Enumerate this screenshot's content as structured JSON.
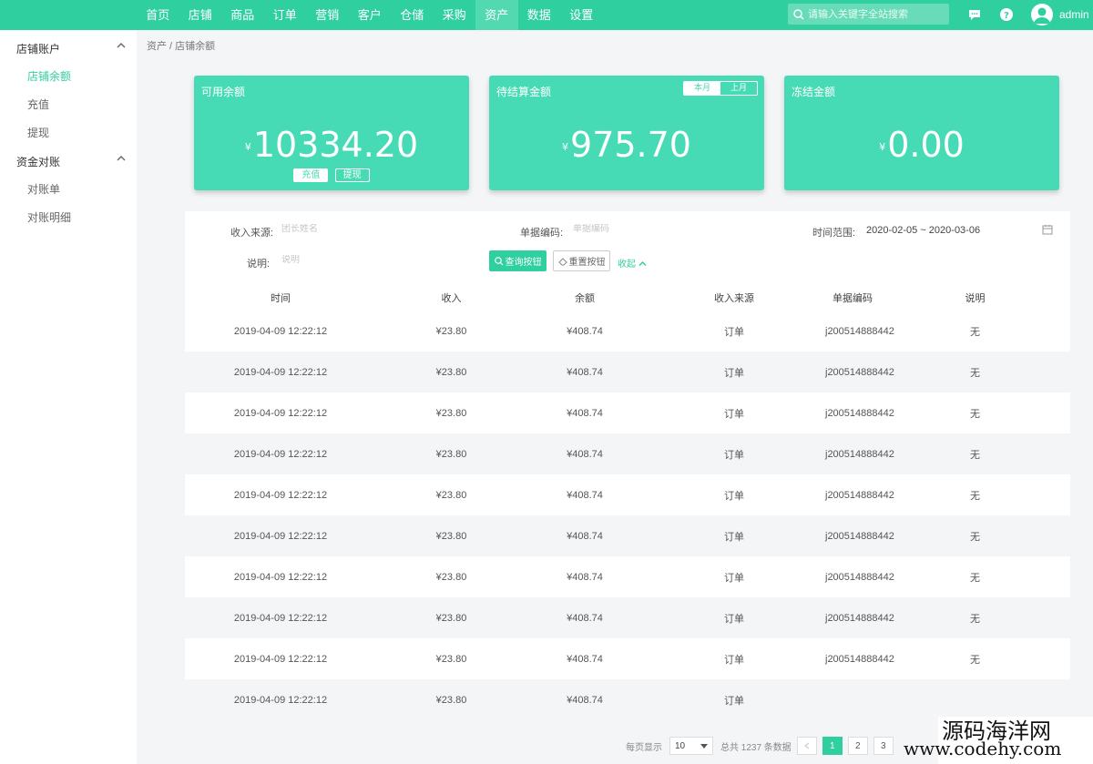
{
  "nav": {
    "items": [
      "首页",
      "店铺",
      "商品",
      "订单",
      "营销",
      "客户",
      "仓储",
      "采购",
      "资产",
      "数据",
      "设置"
    ],
    "active_index": 8,
    "search_placeholder": "请输入关键字全站搜索",
    "user": "admin"
  },
  "sidebar": {
    "groups": [
      {
        "title": "店铺账户",
        "items": [
          "店铺余额",
          "充值",
          "提现"
        ]
      },
      {
        "title": "资金对账",
        "items": [
          "对账单",
          "对账明细"
        ]
      }
    ],
    "active_item": "店铺余额"
  },
  "breadcrumb": "资产 / 店铺余额",
  "cards": {
    "available": {
      "title": "可用余额",
      "currency": "¥",
      "amount": "10334.20",
      "btn_recharge": "充值",
      "btn_withdraw": "提现"
    },
    "pending": {
      "title": "待结算金额",
      "currency": "¥",
      "amount": "975.70",
      "toggle_this": "本月",
      "toggle_last": "上月"
    },
    "frozen": {
      "title": "冻结金额",
      "currency": "¥",
      "amount": "0.00"
    }
  },
  "filter": {
    "source_label": "收入来源:",
    "source_placeholder": "团长姓名",
    "code_label": "单据编码:",
    "code_placeholder": "单据编码",
    "time_label": "时间范围:",
    "time_value": "2020-02-05 ~ 2020-03-06",
    "note_label": "说明:",
    "note_placeholder": "说明",
    "query_btn": "查询按钮",
    "reset_btn": "重置按钮",
    "collapse": "收起"
  },
  "table": {
    "headers": [
      "时间",
      "收入",
      "余额",
      "收入来源",
      "单据编码",
      "说明"
    ],
    "rows": [
      [
        "2019-04-09 12:22:12",
        "¥23.80",
        "¥408.74",
        "订单",
        "j200514888442",
        "无"
      ],
      [
        "2019-04-09 12:22:12",
        "¥23.80",
        "¥408.74",
        "订单",
        "j200514888442",
        "无"
      ],
      [
        "2019-04-09 12:22:12",
        "¥23.80",
        "¥408.74",
        "订单",
        "j200514888442",
        "无"
      ],
      [
        "2019-04-09 12:22:12",
        "¥23.80",
        "¥408.74",
        "订单",
        "j200514888442",
        "无"
      ],
      [
        "2019-04-09 12:22:12",
        "¥23.80",
        "¥408.74",
        "订单",
        "j200514888442",
        "无"
      ],
      [
        "2019-04-09 12:22:12",
        "¥23.80",
        "¥408.74",
        "订单",
        "j200514888442",
        "无"
      ],
      [
        "2019-04-09 12:22:12",
        "¥23.80",
        "¥408.74",
        "订单",
        "j200514888442",
        "无"
      ],
      [
        "2019-04-09 12:22:12",
        "¥23.80",
        "¥408.74",
        "订单",
        "j200514888442",
        "无"
      ],
      [
        "2019-04-09 12:22:12",
        "¥23.80",
        "¥408.74",
        "订单",
        "j200514888442",
        "无"
      ],
      [
        "2019-04-09 12:22:12",
        "¥23.80",
        "¥408.74",
        "订单",
        "",
        ""
      ]
    ]
  },
  "pagination": {
    "per_page_label": "每页显示",
    "per_page": "10",
    "total_label": "总共 1237 条数据",
    "pages": [
      "1",
      "2",
      "3"
    ],
    "current": "1"
  },
  "watermark": {
    "line1": "源码海洋网",
    "line2": "www.codehy.com"
  },
  "colors": {
    "accent": "#2fcf9f",
    "card": "#47dbb5",
    "background": "#f4f5f7"
  }
}
